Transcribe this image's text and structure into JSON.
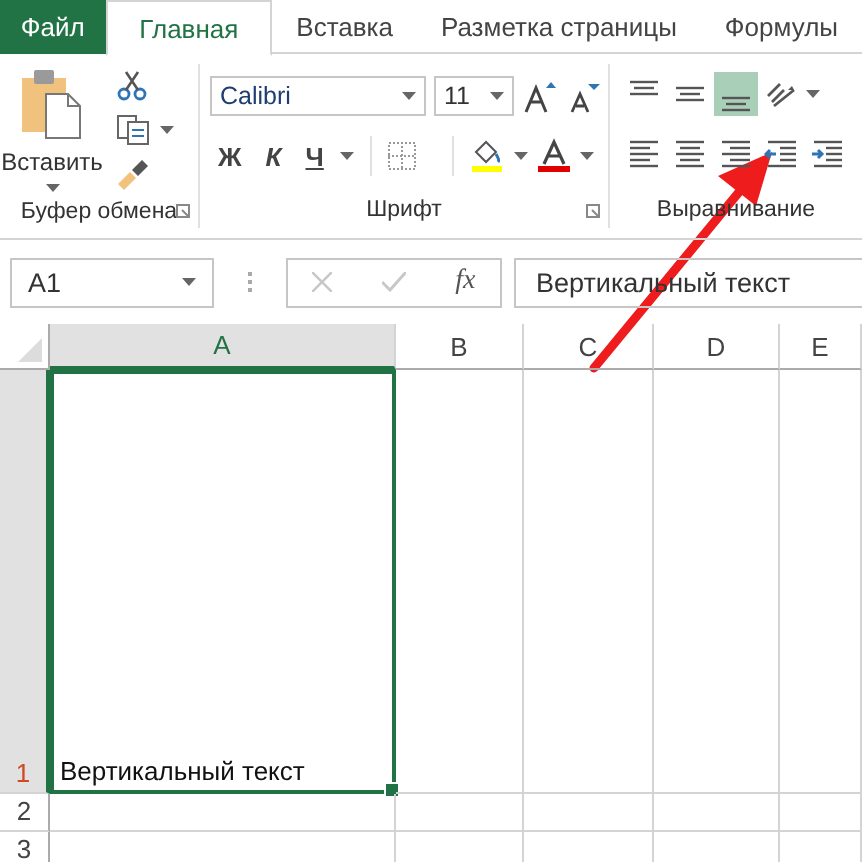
{
  "tabs": [
    {
      "label": "Файл",
      "kind": "file",
      "selected": false
    },
    {
      "label": "Главная",
      "kind": "tab",
      "selected": true
    },
    {
      "label": "Вставка",
      "kind": "tab",
      "selected": false
    },
    {
      "label": "Разметка страницы",
      "kind": "tab",
      "selected": false
    },
    {
      "label": "Формулы",
      "kind": "tab",
      "selected": false
    }
  ],
  "ribbon": {
    "paste_label": "Вставить",
    "font_name": "Calibri",
    "font_size": "11",
    "bold": "Ж",
    "italic": "К",
    "underline": "Ч",
    "groups": [
      {
        "label": "Буфер обмена",
        "launcher": true
      },
      {
        "label": "Шрифт",
        "launcher": true
      },
      {
        "label": "Выравнивание",
        "launcher": false
      }
    ],
    "alignment_buttons": [
      {
        "kind": "top",
        "selected": false
      },
      {
        "kind": "middle",
        "selected": false
      },
      {
        "kind": "bottom",
        "selected": true
      },
      {
        "kind": "orientation",
        "selected": false
      },
      {
        "kind": "left",
        "selected": false
      },
      {
        "kind": "center",
        "selected": false
      },
      {
        "kind": "right",
        "selected": false
      },
      {
        "kind": "indent-decrease",
        "selected": false
      },
      {
        "kind": "indent-increase",
        "selected": false
      }
    ]
  },
  "formula_bar": {
    "name_box": "A1",
    "fx": "fx",
    "formula": "Вертикальный текст"
  },
  "columns": [
    {
      "label": "A",
      "selected": true
    },
    {
      "label": "B",
      "selected": false
    },
    {
      "label": "C",
      "selected": false
    },
    {
      "label": "D",
      "selected": false
    },
    {
      "label": "E",
      "selected": false
    }
  ],
  "rows": [
    {
      "number": "1",
      "selected": true,
      "cells": [
        "Вертикальный текст"
      ]
    },
    {
      "number": "2",
      "selected": false,
      "cells": []
    },
    {
      "number": "3",
      "selected": false,
      "cells": []
    }
  ]
}
